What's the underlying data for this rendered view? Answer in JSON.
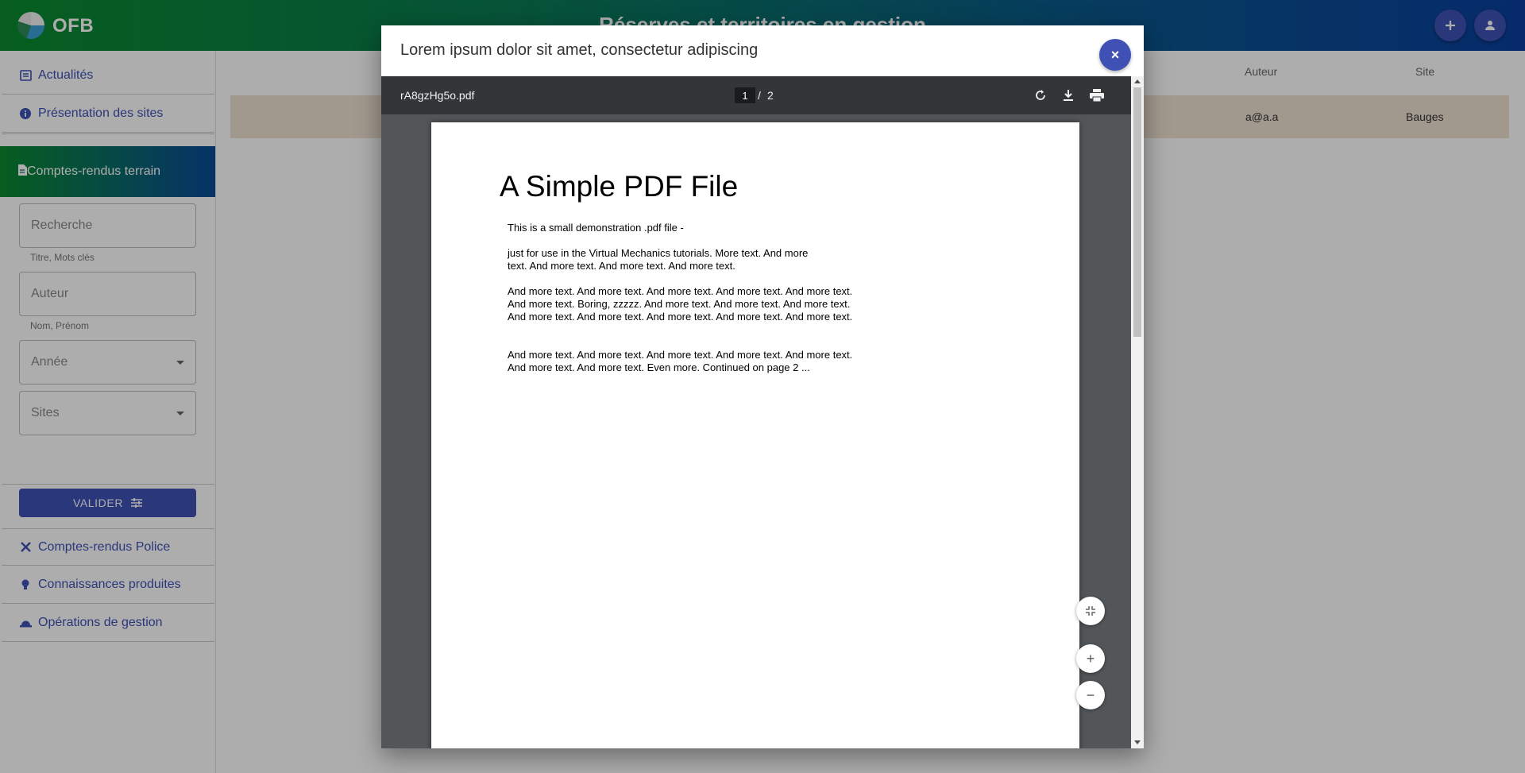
{
  "header": {
    "brand": "OFB",
    "title": "Réserves et territoires en gestion"
  },
  "sidebar": {
    "items_top": [
      {
        "label": "Actualités",
        "icon": "newspaper-icon"
      },
      {
        "label": "Présentation des sites",
        "icon": "info-icon"
      }
    ],
    "active": {
      "label": "Comptes-rendus terrain",
      "icon": "document-icon"
    },
    "search": {
      "placeholder": "Recherche",
      "hint": "Titre, Mots clés"
    },
    "author": {
      "placeholder": "Auteur",
      "hint": "Nom, Prénom"
    },
    "year": {
      "placeholder": "Année"
    },
    "sites": {
      "placeholder": "Sites"
    },
    "submit_label": "VALIDER",
    "items_bottom": [
      {
        "label": "Comptes-rendus Police",
        "icon": "tools-icon"
      },
      {
        "label": "Connaissances produites",
        "icon": "lightbulb-icon"
      },
      {
        "label": "Opérations de gestion",
        "icon": "helmet-icon"
      }
    ]
  },
  "table": {
    "columns": {
      "author": "Auteur",
      "site": "Site"
    },
    "row": {
      "author": "a@a.a",
      "site": "Bauges"
    }
  },
  "modal": {
    "title": "Lorem ipsum dolor sit amet, consectetur adipiscing",
    "close": "×",
    "viewer": {
      "filename": "rA8gzHg5o.pdf",
      "current_page": "1",
      "separator": "/",
      "total_pages": "2"
    },
    "pdf": {
      "title": "A Simple PDF File",
      "paragraphs": [
        "This is a small demonstration .pdf file -",
        "just for use in the Virtual Mechanics tutorials. More text. And more text. And more text. And more text. And more text.",
        "And more text. And more text. And more text. And more text. And more text. And more text. Boring, zzzzz. And more text. And more text. And more text. And more text. And more text. And more text. And more text. And more text.",
        "And more text. And more text. And more text. And more text. And more text. And more text. And more text. Even more. Continued on page 2 ..."
      ]
    },
    "zoom": {
      "fit": "fit-page",
      "in": "+",
      "out": "−"
    }
  },
  "colors": {
    "primary": "#3f51b5",
    "header_start": "#0a8a2e",
    "header_end": "#0a3f9e"
  }
}
